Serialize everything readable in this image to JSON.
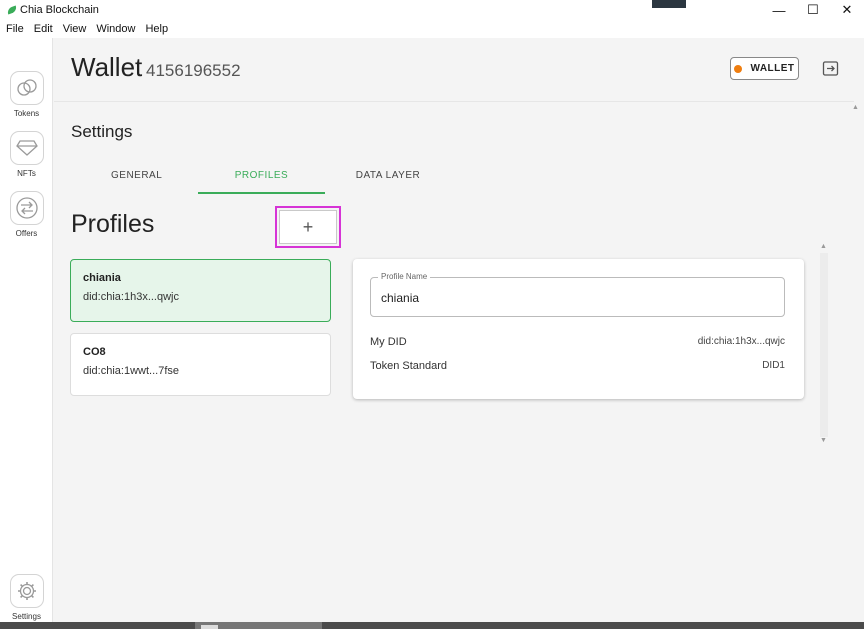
{
  "window": {
    "title": "Chia Blockchain",
    "controls": [
      "—",
      "☐",
      "✕"
    ]
  },
  "menu": [
    "File",
    "Edit",
    "View",
    "Window",
    "Help"
  ],
  "sidebar": {
    "items": [
      {
        "label": "Tokens",
        "icon": "tokens-icon"
      },
      {
        "label": "NFTs",
        "icon": "diamond-icon"
      },
      {
        "label": "Offers",
        "icon": "swap-arrows-icon"
      },
      {
        "label": "Settings",
        "icon": "gear-icon"
      }
    ]
  },
  "header": {
    "title": "Wallet",
    "wallet_id": "4156196552",
    "wallet_button": "WALLET",
    "status_color": "#ef7e10"
  },
  "settings": {
    "title": "Settings",
    "tabs": [
      {
        "label": "GENERAL",
        "active": false
      },
      {
        "label": "PROFILES",
        "active": true
      },
      {
        "label": "DATA LAYER",
        "active": false
      }
    ]
  },
  "profiles": {
    "title": "Profiles",
    "add_label": "+",
    "list": [
      {
        "name": "chiania",
        "did": "did:chia:1h3x...qwjc",
        "selected": true
      },
      {
        "name": "CO8",
        "did": "did:chia:1wwt...7fse",
        "selected": false
      }
    ]
  },
  "detail": {
    "field_label": "Profile Name",
    "field_value": "chiania",
    "rows": [
      {
        "key": "My DID",
        "value": "did:chia:1h3x...qwjc"
      },
      {
        "key": "Token Standard",
        "value": "DID1"
      }
    ]
  },
  "colors": {
    "accent": "#3aac59",
    "highlight": "#d633d6"
  }
}
